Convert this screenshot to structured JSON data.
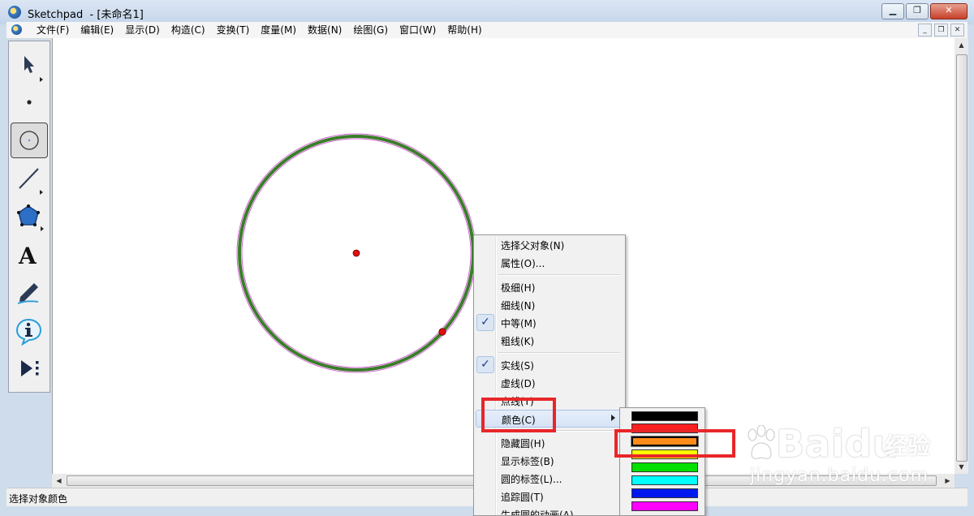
{
  "window": {
    "app_name": "Sketchpad",
    "doc_title": "- [未命名1]"
  },
  "menubar": {
    "items": [
      "文件(F)",
      "编辑(E)",
      "显示(D)",
      "构造(C)",
      "变换(T)",
      "度量(M)",
      "数据(N)",
      "绘图(G)",
      "窗口(W)",
      "帮助(H)"
    ]
  },
  "toolbox": {
    "tools": [
      "arrow-select-icon",
      "point-icon",
      "compass-circle-icon",
      "straightedge-icon",
      "polygon-icon",
      "text-icon",
      "marker-icon",
      "info-icon",
      "custom-tool-icon"
    ],
    "selected": "compass-circle-icon",
    "text_tool_glyph": "A"
  },
  "canvas": {
    "circle_colors": {
      "outline": "#3a7d2a",
      "selection_halo": "#d060d0",
      "points": "#e01010"
    }
  },
  "context_menu": {
    "items": [
      {
        "label": "选择父对象(N)"
      },
      {
        "label": "属性(O)..."
      },
      {
        "label": "极细(H)"
      },
      {
        "label": "细线(N)"
      },
      {
        "label": "中等(M)",
        "checked": true
      },
      {
        "label": "粗线(K)"
      },
      {
        "label": "实线(S)",
        "checked": true
      },
      {
        "label": "虚线(D)"
      },
      {
        "label": "点线(T)"
      },
      {
        "label": "颜色(C)",
        "submenu": true,
        "highlighted": true
      },
      {
        "label": "隐藏圆(H)"
      },
      {
        "label": "显示标签(B)"
      },
      {
        "label": "圆的标签(L)..."
      },
      {
        "label": "追踪圆(T)"
      },
      {
        "label": "生成圆的动画(A)"
      }
    ],
    "check_glyph": "✓"
  },
  "color_submenu": {
    "swatches": [
      "#000000",
      "#ff2020",
      "#ff8c1a",
      "#ffff00",
      "#00e000",
      "#00ffff",
      "#0018f0",
      "#ff00ff"
    ],
    "selected_index": 2
  },
  "statusbar": {
    "text": "选择对象颜色"
  },
  "watermark": {
    "brand": "Bai",
    "brand_suffix": "du",
    "brand_cn": "经验",
    "url": "jingyan.baidu.com"
  }
}
